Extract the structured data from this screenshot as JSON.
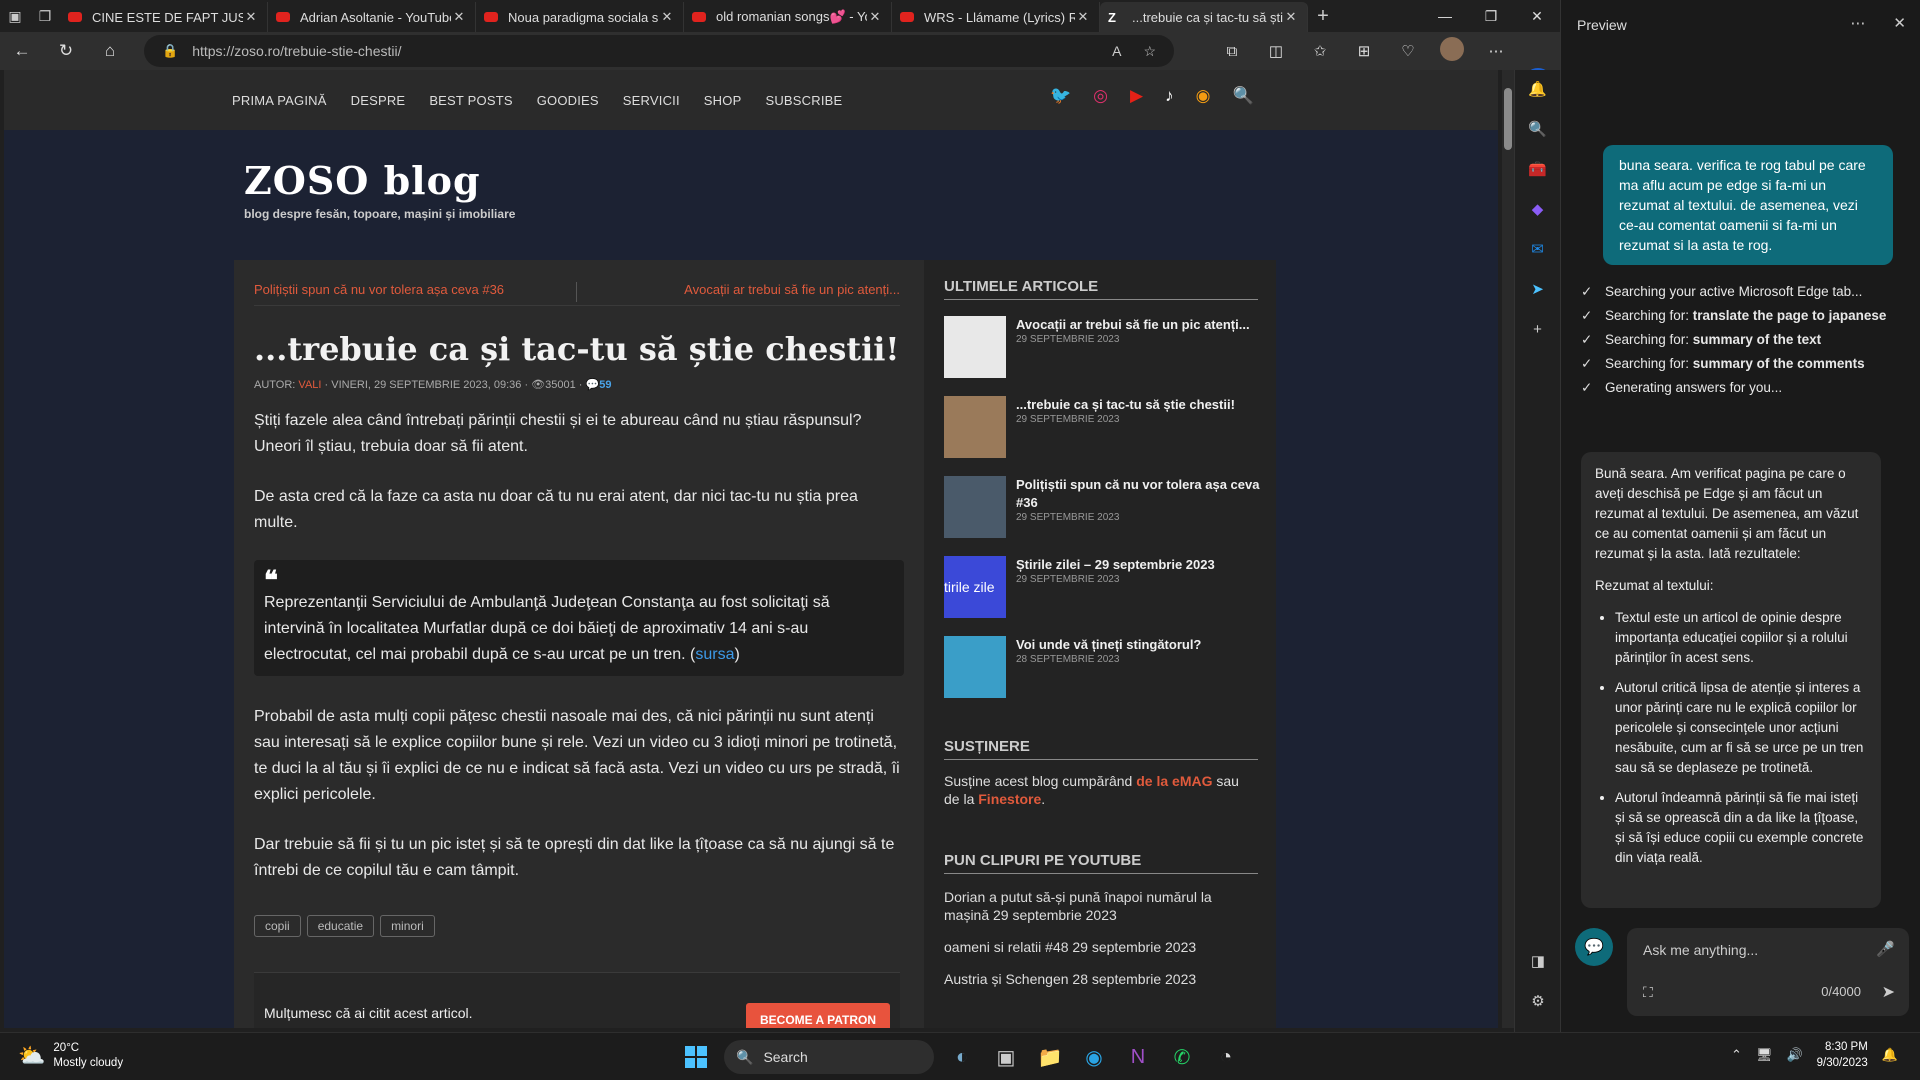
{
  "tabs": [
    {
      "title": "CINE ESTE DE FAPT JUSTIŢI"
    },
    {
      "title": "Adrian Asoltanie - YouTube"
    },
    {
      "title": "Noua paradigma sociala si"
    },
    {
      "title": "old romanian songs💕 - Yo"
    },
    {
      "title": "WRS - Llámame (Lyrics) Ro"
    },
    {
      "title": "...trebuie ca și tac-tu să știe"
    }
  ],
  "address": {
    "url": "https://zoso.ro/trebuie-stie-chestii/"
  },
  "site": {
    "nav": [
      "PRIMA PAGINĂ",
      "DESPRE",
      "BEST POSTS",
      "GOODIES",
      "SERVICII",
      "SHOP",
      "SUBSCRIBE"
    ],
    "logo": "ZOSO blog",
    "tagline": "blog despre fesăn, topoare, mașini și imobiliare"
  },
  "post": {
    "prev": "Polițiștii spun că nu vor tolera așa ceva #36",
    "next": "Avocații ar trebui să fie un pic atenți...",
    "title": "...trebuie ca și tac-tu să știe chestii!",
    "author_label": "AUTOR:",
    "author": "VALI",
    "date": "VINERI, 29 SEPTEMBRIE 2023, 09:36",
    "views": "35001",
    "comments": "59",
    "p1": "Știți fazele alea când întrebați părinții chestii și ei te abureau când nu știau răspunsul? Uneori îl știau, trebuia doar să fii atent.",
    "p2": "De asta cred că la faze ca asta nu doar că tu nu erai atent, dar nici tac-tu nu știa prea multe.",
    "quote": "Reprezentanţii Serviciului de Ambulanţă Judeţean Constanţa au fost solicitaţi să intervină în localitatea Murfatlar după ce doi băieţi de aproximativ 14 ani s-au electrocutat, cel mai probabil după ce s-au urcat pe un tren. (",
    "quote_link": "sursa",
    "quote_end": ")",
    "p3": "Probabil de asta mulți copii pățesc chestii nasoale mai des, că nici părinții nu sunt atenți sau interesați să le explice copiilor bune și rele. Vezi un video cu 3 idioți minori pe trotinetă, te duci la al tău și îi explici de ce nu e indicat să facă asta. Vezi un video cu urs pe stradă, îi explici pericolele.",
    "p4": "Dar trebuie să fii și tu un pic isteț și să te oprești din dat like la țîțoase ca să nu ajungi să te întrebi de ce copilul tău e cam tâmpit.",
    "tags": [
      "copii",
      "educatie",
      "minori"
    ],
    "thanks": "Mulțumesc că ai citit acest articol.",
    "patron": "BECOME A PATRON"
  },
  "sidebar": {
    "latest_title": "ULTIMELE ARTICOLE",
    "articles": [
      {
        "title": "Avocații ar trebui să fie un pic atenți...",
        "date": "29 SEPTEMBRIE 2023",
        "thumb": "#e8e8e8"
      },
      {
        "title": "...trebuie ca și tac-tu să știe chestii!",
        "date": "29 SEPTEMBRIE 2023",
        "thumb": "#9a7a5a"
      },
      {
        "title": "Polițiștii spun că nu vor tolera așa ceva #36",
        "date": "29 SEPTEMBRIE 2023",
        "thumb": "#4a5a6a"
      },
      {
        "title": "Știrile zilei – 29 septembrie 2023",
        "date": "29 SEPTEMBRIE 2023",
        "thumb": "#3b49d8",
        "thumb_text": "tirile zile"
      },
      {
        "title": "Voi unde vă țineți stingătorul?",
        "date": "28 SEPTEMBRIE 2023",
        "thumb": "#3a9ec8"
      }
    ],
    "support_title": "SUSȚINERE",
    "support_pre": "Susține acest blog cumpărând ",
    "support_link1": "de la eMAG",
    "support_mid": " sau de la ",
    "support_link2": "Finestore",
    "support_end": ".",
    "yt_title": "PUN CLIPURI PE YOUTUBE",
    "yt": [
      "Dorian a putut să-și pună înapoi numărul la mașină 29 septembrie 2023",
      "oameni si relatii #48 29 septembrie 2023",
      "Austria și Schengen 28 septembrie 2023"
    ]
  },
  "copilot": {
    "header": "Preview",
    "user_message": "buna seara. verifica te rog tabul pe care ma aflu acum pe edge si fa-mi un rezumat al textului. de asemenea, vezi ce-au comentat oamenii si fa-mi un rezumat si la asta te rog.",
    "steps": [
      {
        "pre": "Searching your active Microsoft Edge tab...",
        "bold": ""
      },
      {
        "pre": "Searching for: ",
        "bold": "translate the page to japanese"
      },
      {
        "pre": "Searching for: ",
        "bold": "summary of the text"
      },
      {
        "pre": "Searching for: ",
        "bold": "summary of the comments"
      },
      {
        "pre": "Generating answers for you...",
        "bold": ""
      }
    ],
    "answer_intro": "Bună seara. Am verificat pagina pe care o aveți deschisă pe Edge și am făcut un rezumat al textului. De asemenea, am văzut ce au comentat oamenii și am făcut un rezumat și la asta. Iată rezultatele:",
    "answer_heading": "Rezumat al textului:",
    "answer_points": [
      "Textul este un articol de opinie despre importanța educației copiilor și a rolului părinților în acest sens.",
      "Autorul critică lipsa de atenție și interes a unor părinți care nu le explică copiilor lor pericolele și consecințele unor acțiuni nesăbuite, cum ar fi să se urce pe un tren sau să se deplaseze pe trotinetă.",
      "Autorul îndeamnă părinții să fie mai isteți și să se oprească din a da like la țîțoase, și să își educe copiii cu exemple concrete din viața reală."
    ],
    "input_placeholder": "Ask me anything...",
    "counter": "0/4000"
  },
  "taskbar": {
    "temp": "20°C",
    "weather": "Mostly cloudy",
    "search": "Search",
    "time": "8:30 PM",
    "date": "9/30/2023"
  },
  "colors": {
    "accent": "#e05a3c",
    "copilot": "#0e6b7a",
    "page_bg": "#1c2233"
  }
}
